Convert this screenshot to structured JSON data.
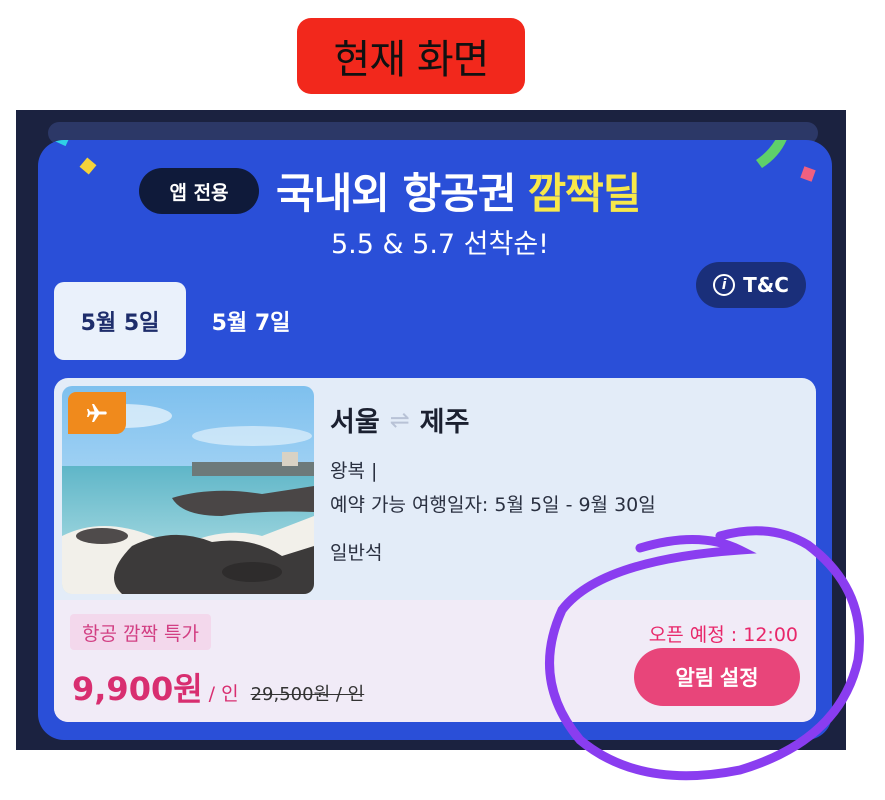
{
  "tag": {
    "label": "현재 화면"
  },
  "header": {
    "app_only": "앱 전용",
    "title": "국내외 항공권",
    "title_highlight": "깜짝딜",
    "subtitle": "5.5 & 5.7 선착순!",
    "tnc_label": "T&C"
  },
  "tabs": [
    {
      "label": "5월 5일",
      "active": true
    },
    {
      "label": "5월 7일",
      "active": false
    }
  ],
  "product": {
    "origin": "서울",
    "destination": "제주",
    "trip_type": "왕복 |",
    "travel_dates": "예약 가능 여행일자:  5월 5일  - 9월 30일",
    "cabin": "일반석",
    "promo_label": "항공 깜짝 특가",
    "price": "9,900원",
    "price_unit": "/ 인",
    "original_price": "29,500원 / 인",
    "open_time": "오픈 예정 : 12:00",
    "alarm_button": "알림 설정"
  },
  "colors": {
    "tag_bg": "#f2281c",
    "card_bg": "#2a4fd8",
    "highlight": "#f8e84a",
    "price": "#d82e70",
    "alarm_button": "#e8457a",
    "annotation_circle": "#8a3df0"
  },
  "icons": [
    "info-icon",
    "plane-icon",
    "exchange-arrow-icon"
  ]
}
